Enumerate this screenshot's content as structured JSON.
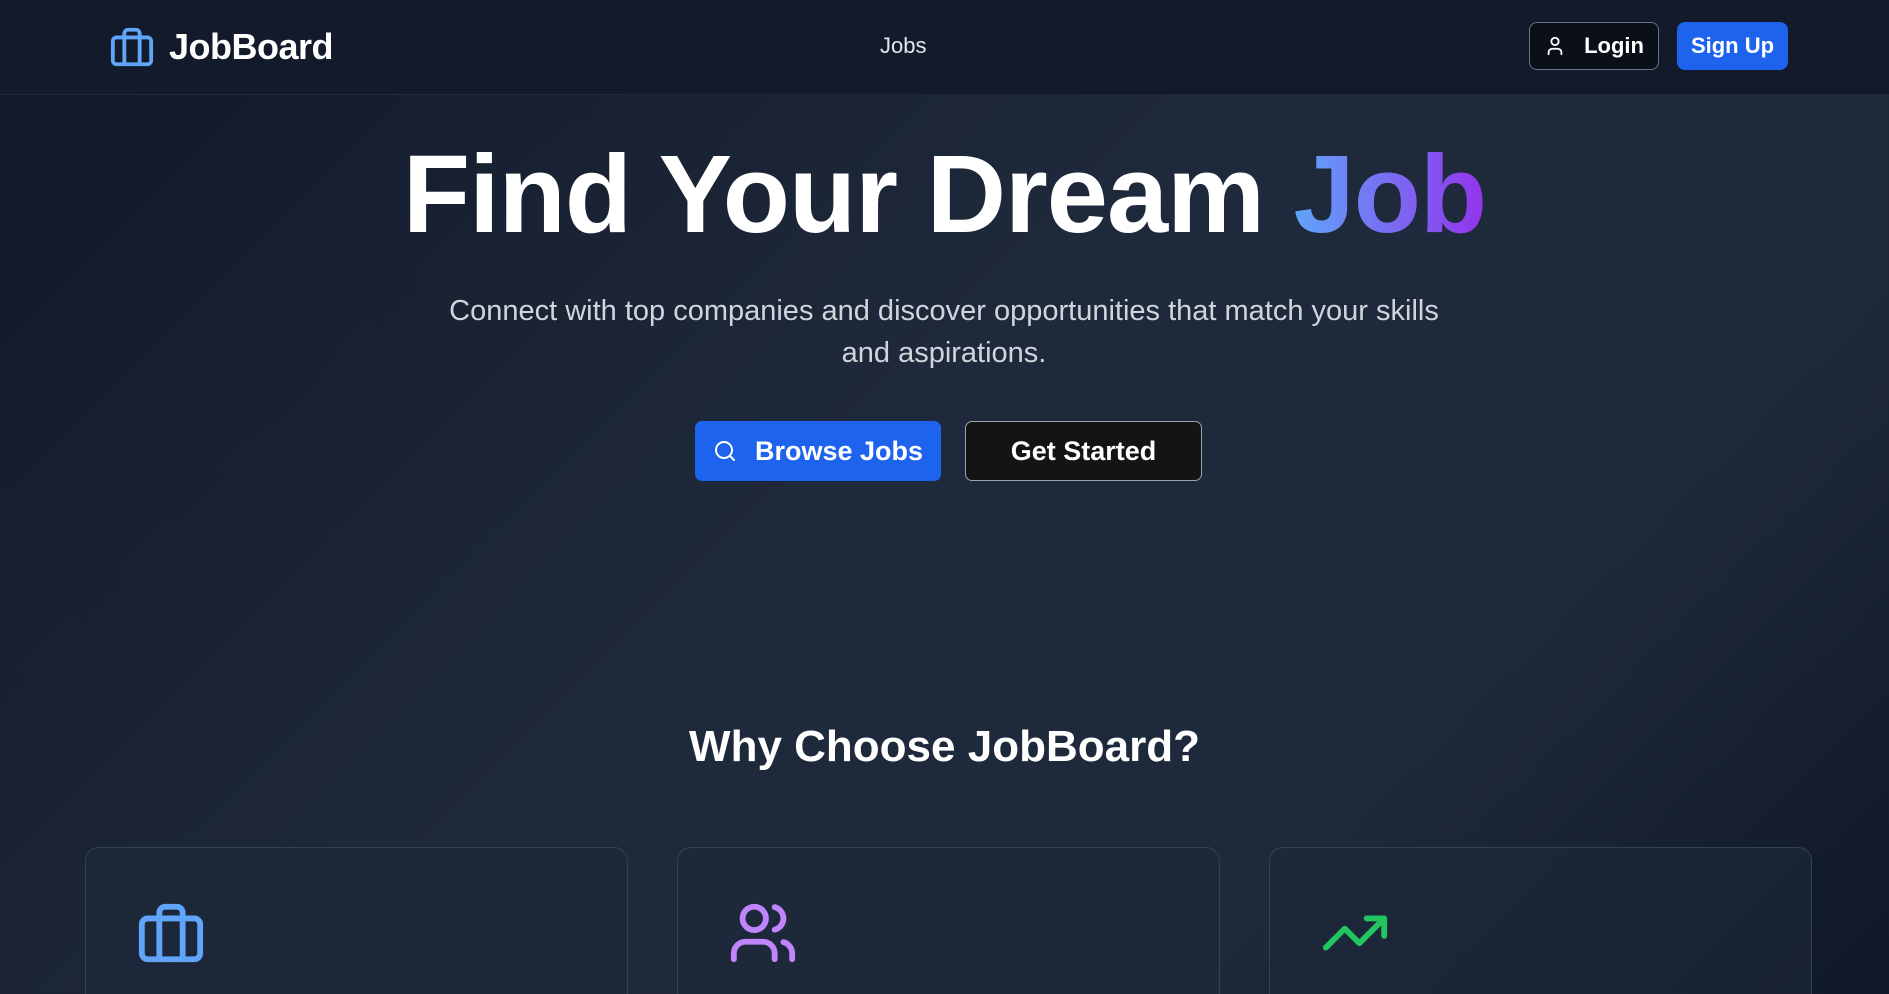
{
  "header": {
    "brand": "JobBoard",
    "nav": {
      "jobs_label": "Jobs"
    },
    "login_label": "Login",
    "signup_label": "Sign Up"
  },
  "hero": {
    "title_main": "Find Your Dream",
    "title_accent": "Job",
    "subtitle": "Connect with top companies and discover opportunities that match your skills and aspirations.",
    "browse_label": "Browse Jobs",
    "get_started_label": "Get Started"
  },
  "why": {
    "title": "Why Choose JobBoard?",
    "cards": [
      {
        "icon": "briefcase-icon",
        "color": "#60a5fa"
      },
      {
        "icon": "users-icon",
        "color": "#c084fc"
      },
      {
        "icon": "trending-up-icon",
        "color": "#22c55e"
      }
    ]
  },
  "colors": {
    "primary": "#1d63ed",
    "accent_gradient_start": "#60a5fa",
    "accent_gradient_end": "#9333ea",
    "background": "#1e293b"
  }
}
